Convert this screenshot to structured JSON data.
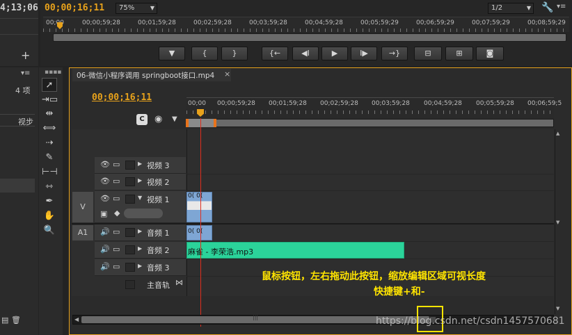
{
  "left_panel": {
    "timecode": "4;13;06",
    "count_label": "4 项",
    "col_header": "视步"
  },
  "source_monitor": {
    "timecode": "00;00;16;11",
    "zoom": "75%",
    "resolution": "1/2",
    "ruler_labels": [
      "00;00",
      "00;00;59;28",
      "00;01;59;28",
      "00;02;59;28",
      "00;03;59;28",
      "00;04;59;28",
      "00;05;59;29",
      "00;06;59;29",
      "00;07;59;29",
      "00;08;59;29"
    ],
    "transport_buttons": [
      {
        "name": "marker-button",
        "glyph": "▼"
      },
      {
        "name": "mark-in-button",
        "glyph": "{"
      },
      {
        "name": "mark-out-button",
        "glyph": "}"
      },
      {
        "name": "go-to-in-button",
        "glyph": "{←"
      },
      {
        "name": "step-back-button",
        "glyph": "◀I"
      },
      {
        "name": "play-button",
        "glyph": "▶"
      },
      {
        "name": "step-forward-button",
        "glyph": "I▶"
      },
      {
        "name": "go-to-out-button",
        "glyph": "→}"
      },
      {
        "name": "lift-button",
        "glyph": "⊟"
      },
      {
        "name": "extract-button",
        "glyph": "⊞"
      },
      {
        "name": "export-frame-button",
        "glyph": "◙"
      }
    ]
  },
  "timeline": {
    "tab_title": "06-微信小程序调用 springboot接口.mp4",
    "tab_close": "×",
    "timecode": "00;00;16;11",
    "ruler_labels": [
      "00;00",
      "00;00;59;28",
      "00;01;59;28",
      "00;02;59;28",
      "00;03;59;28",
      "00;04;59;28",
      "00;05;59;28",
      "00;06;59;5"
    ],
    "tracks": [
      {
        "id": "",
        "name": "视频 3"
      },
      {
        "id": "",
        "name": "视频 2"
      },
      {
        "id": "V",
        "name": "视频 1"
      },
      {
        "id": "A1",
        "name": "音频 1"
      },
      {
        "id": "",
        "name": "音频 2"
      },
      {
        "id": "",
        "name": "音频 3"
      },
      {
        "id": "",
        "name": "主音轨"
      }
    ],
    "video_clip_label": "0( 0(",
    "audio_clip_1_label": "0( 0(",
    "audio_clip_2_label": "麻雀 - 李荣浩.mp3",
    "annotation_line1": "鼠标按钮，左右拖动此按钮，缩放编辑区域可视长度",
    "annotation_line2": "快捷键+和-",
    "watermark": "https://blog.csdn.net/csdn1457570681"
  },
  "colors": {
    "timecode": "#e8a21b",
    "playhead": "#e02e1e",
    "audio_clip": "#2bd39a",
    "video_clip": "#7ea6d4",
    "annotation": "#ffe400"
  }
}
